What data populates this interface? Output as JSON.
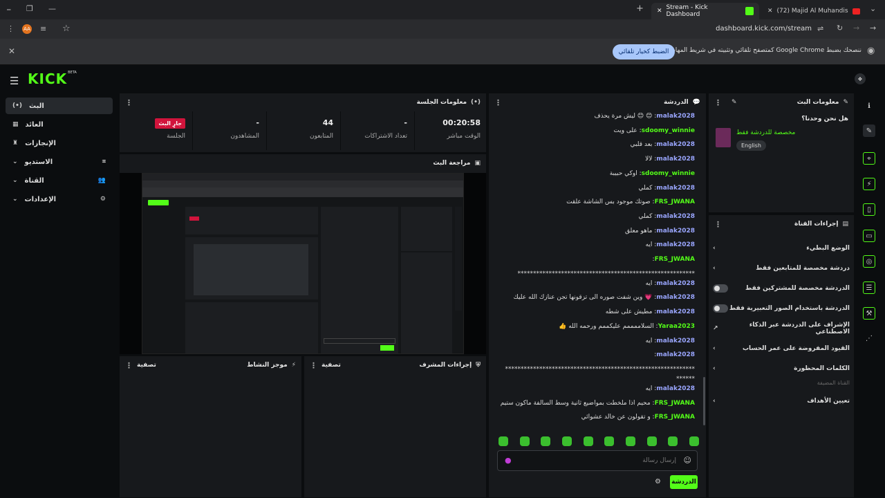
{
  "browser": {
    "tabs": [
      {
        "label": "Stream - Kick Dashboard"
      },
      {
        "label": "(72) Majid Al Muhandis - Ala Al..."
      }
    ],
    "url": "dashboard.kick.com/stream",
    "infobar": {
      "text": "ننصحك بضبط Google Chrome كمتصفح تلقائي وتثبيته في شريط المهام",
      "button": "الضبط كخيار تلقائي"
    }
  },
  "app": {
    "logo": "KICK",
    "logo_badge": "BETA",
    "sidebar": [
      {
        "label": "البث"
      },
      {
        "label": "العائد"
      },
      {
        "label": "الإنجازات"
      },
      {
        "label": "الاستديو"
      },
      {
        "label": "القناة"
      },
      {
        "label": "الإعدادات"
      }
    ],
    "session": {
      "title": "معلومات الجلسة",
      "live_badge": "جارٍ البث",
      "live_label": "الجلسة",
      "stats": [
        {
          "value": "-",
          "label": "المشاهدون"
        },
        {
          "value": "44",
          "label": "المتابعون"
        },
        {
          "value": "-",
          "label": "تعداد الاشتراكات"
        },
        {
          "value": "00:20:58",
          "label": "الوقت مباشر"
        }
      ]
    },
    "preview": {
      "title": "مراجعة البث"
    },
    "activity": {
      "title": "موجز النشاط",
      "filter": "تصفية"
    },
    "mod_actions": {
      "title": "إجراءات المشرف",
      "filter": "تصفية"
    },
    "chat": {
      "title": "الدردشة",
      "messages": [
        {
          "user": "malak2028",
          "text": "😊 😊 ليش مرة يحذف"
        },
        {
          "user": "sdoomy_winnie",
          "text": "على ويت"
        },
        {
          "user": "malak2028",
          "text": "بعد قلبي"
        },
        {
          "user": "malak2028",
          "text": "لالا"
        },
        {
          "user": "sdoomy_winnie",
          "text": "اوكي حبيبة"
        },
        {
          "user": "malak2028",
          "text": "كملي"
        },
        {
          "user": "FRS_JWANA",
          "text": "صوتك موجود بس الشاشة علقت"
        },
        {
          "user": "malak2028",
          "text": "كملي"
        },
        {
          "user": "malak2028",
          "text": "ماهو معلق"
        },
        {
          "user": "malak2028",
          "text": "ايه"
        },
        {
          "user": "FRS_JWANA",
          "text": ""
        },
        {
          "user": "",
          "text": "*********************************************************"
        },
        {
          "user": "malak2028",
          "text": "ايه"
        },
        {
          "user": "malak2028",
          "text": "💗 وين شفت صوره الى تزقونها تجن عنازك الله عليك"
        },
        {
          "user": "malak2028",
          "text": "مطيش على شطه"
        },
        {
          "user": "Yaraa2023",
          "text": "السلاممممم عليكممم ورحمه الله 👍"
        },
        {
          "user": "malak2028",
          "text": "ايه"
        },
        {
          "user": "malak2028",
          "text": ""
        },
        {
          "user": "",
          "text": "*************************************************************"
        },
        {
          "user": "",
          "text": "******"
        },
        {
          "user": "malak2028",
          "text": "ايه"
        },
        {
          "user": "FRS_JWANA",
          "text": "محيم اذا ملخطت بمواضيع ثانية وسط السالفة ماكون ستيم"
        },
        {
          "user": "FRS_JWANA",
          "text": "و تقولون عن خالد عشوائي"
        }
      ],
      "input_placeholder": "إرسال رسالة",
      "send_button": "الدردشة"
    },
    "stream_info": {
      "title": "معلومات البث",
      "stream_title": "هل نحن وحدنا؟",
      "category": "مخصصة للدردشة فقط",
      "language": "English"
    },
    "channel_actions": {
      "title": "إجراءات القناة",
      "items": [
        {
          "label": "الوضع البطيء",
          "kind": "chevron"
        },
        {
          "label": "دردشة مخصصة للمتابعين فقط",
          "kind": "chevron"
        },
        {
          "label": "الدردشة مخصصة للمشتركين فقط",
          "kind": "toggle"
        },
        {
          "label": "الدردشة باستخدام الصور التعبيرية فقط",
          "kind": "toggle"
        },
        {
          "label": "الإشراف على الدردشة عبر الذكاء الاصطناعي",
          "kind": "external"
        },
        {
          "label": "القيود المفروضة على عمر الحساب",
          "kind": "chevron"
        },
        {
          "label": "الكلمات المحظورة",
          "kind": "chevron"
        }
      ],
      "section_label": "القناة المضيفة",
      "extra_item": "تعيين الأهداف"
    }
  }
}
